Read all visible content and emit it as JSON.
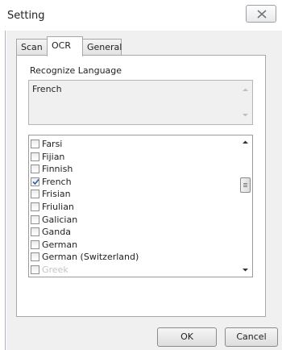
{
  "window": {
    "title": "Setting",
    "close_icon": "close-x-icon"
  },
  "tabs": [
    {
      "label": "Scan",
      "active": false
    },
    {
      "label": "OCR",
      "active": true
    },
    {
      "label": "General",
      "active": false
    }
  ],
  "ocr": {
    "section_label": "Recognize Language",
    "selected_languages": "French",
    "languages": [
      {
        "label": "Farsi",
        "checked": false
      },
      {
        "label": "Fijian",
        "checked": false
      },
      {
        "label": "Finnish",
        "checked": false
      },
      {
        "label": "French",
        "checked": true
      },
      {
        "label": "Frisian",
        "checked": false
      },
      {
        "label": "Friulian",
        "checked": false
      },
      {
        "label": "Galician",
        "checked": false
      },
      {
        "label": "Ganda",
        "checked": false
      },
      {
        "label": "German",
        "checked": false
      },
      {
        "label": "German (Switzerland)",
        "checked": false
      },
      {
        "label": "Greek",
        "checked": false
      }
    ]
  },
  "buttons": {
    "ok": "OK",
    "cancel": "Cancel"
  },
  "colors": {
    "window_bg": "#f0f0f0",
    "panel_bg": "#ffffff",
    "border": "#a7a7a7",
    "check_mark": "#2f5ea8"
  }
}
